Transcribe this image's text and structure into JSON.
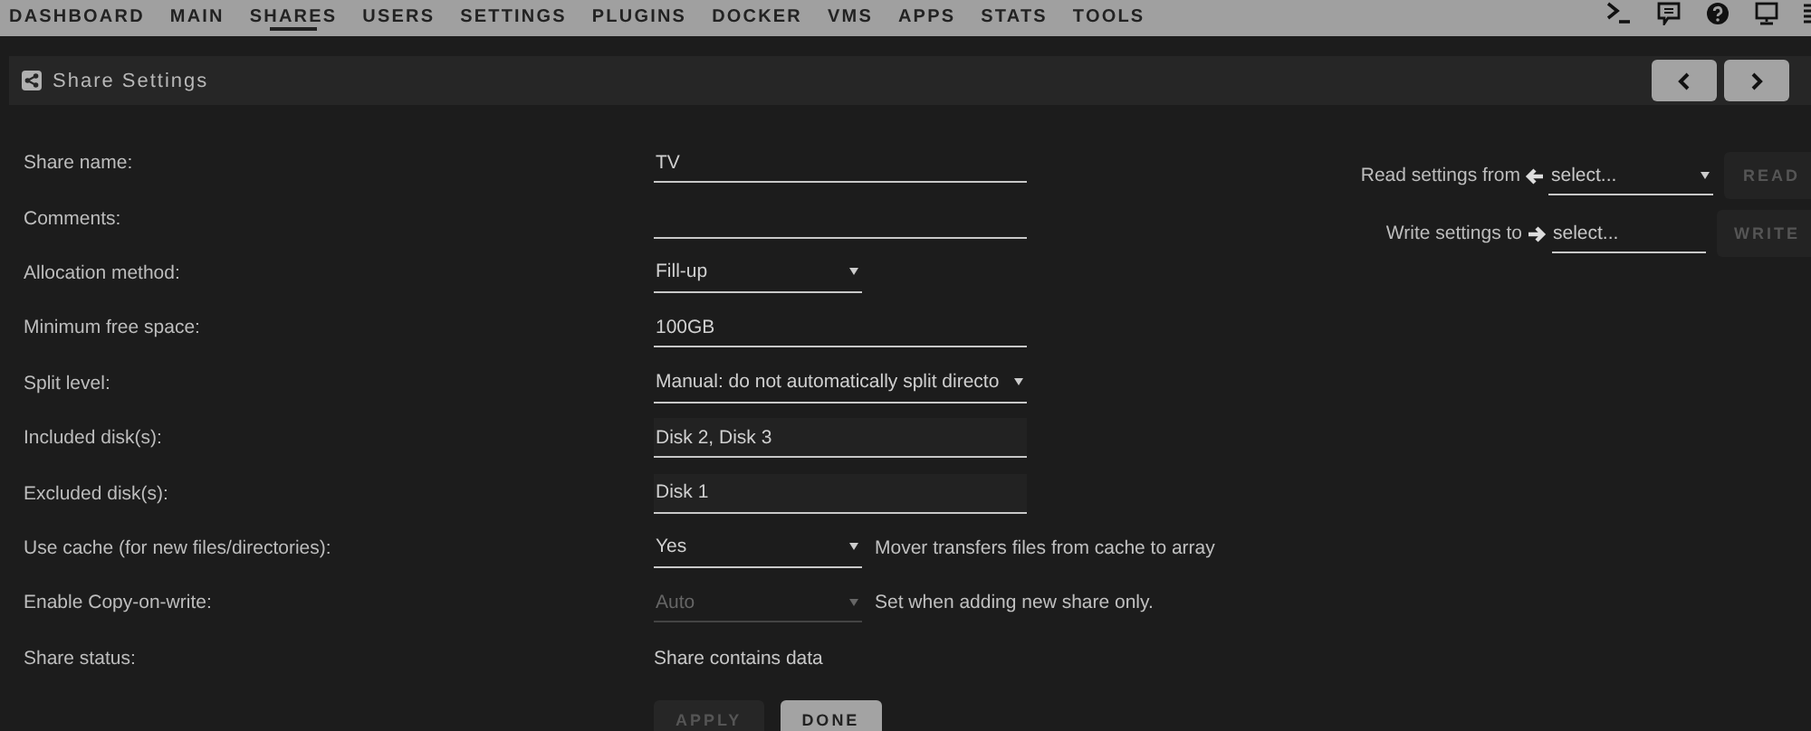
{
  "nav": {
    "items": [
      {
        "label": "DASHBOARD",
        "selected": false
      },
      {
        "label": "MAIN",
        "selected": false
      },
      {
        "label": "SHARES",
        "selected": true
      },
      {
        "label": "USERS",
        "selected": false
      },
      {
        "label": "SETTINGS",
        "selected": false
      },
      {
        "label": "PLUGINS",
        "selected": false
      },
      {
        "label": "DOCKER",
        "selected": false
      },
      {
        "label": "VMS",
        "selected": false
      },
      {
        "label": "APPS",
        "selected": false
      },
      {
        "label": "STATS",
        "selected": false
      },
      {
        "label": "TOOLS",
        "selected": false
      }
    ]
  },
  "panel": {
    "title": "Share Settings"
  },
  "form": {
    "fields": [
      {
        "label": "Share name:",
        "kind": "text",
        "value": "TV"
      },
      {
        "label": "Comments:",
        "kind": "text"
      },
      {
        "label": "Allocation method:",
        "kind": "select",
        "value": "Fill-up",
        "disabled": false
      },
      {
        "label": "Minimum free space:",
        "kind": "text",
        "value": "100GB"
      },
      {
        "label": "Split level:",
        "kind": "wideselect",
        "value": "Manual: do not automatically split directo",
        "disabled": false
      },
      {
        "label": "Included disk(s):",
        "kind": "picker",
        "value": "Disk 2, Disk 3"
      },
      {
        "label": "Excluded disk(s):",
        "kind": "picker",
        "value": "Disk 1"
      },
      {
        "label": "Use cache (for new files/directories):",
        "kind": "select",
        "value": "Yes",
        "disabled": false,
        "note": "Mover transfers files from cache to array"
      },
      {
        "label": "Enable Copy-on-write:",
        "kind": "select",
        "value": "Auto",
        "disabled": true,
        "note": "Set when adding new share only."
      },
      {
        "label": "Share status:",
        "kind": "static",
        "value": "Share contains data"
      }
    ],
    "buttons": [
      {
        "label": "APPLY",
        "disabled": true
      },
      {
        "label": "DONE",
        "disabled": false
      }
    ]
  },
  "side": {
    "read": {
      "label": "Read settings from",
      "placeholder": "select...",
      "button": "READ",
      "disabled": true
    },
    "write": {
      "label": "Write settings to",
      "placeholder": "select...",
      "button": "WRITE",
      "disabled": true
    }
  }
}
